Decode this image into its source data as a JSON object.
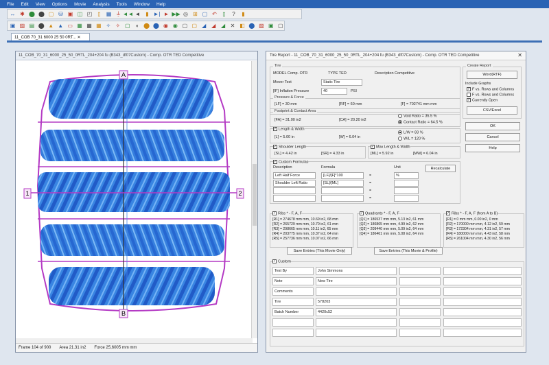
{
  "menu": [
    "File",
    "Edit",
    "View",
    "Options",
    "Movie",
    "Analysis",
    "Tools",
    "Window",
    "Help"
  ],
  "toolbar1": [
    "↔",
    "✱",
    "⬤",
    "⬤",
    "▢",
    "⛁",
    "▣",
    "◫",
    "◰",
    "▯",
    "▦",
    "⏚",
    "◄◄",
    "◄",
    "▮",
    "►|",
    "►",
    "▶▶",
    "◎",
    "⊞",
    "▢",
    "↶",
    "▯",
    "?",
    "▮"
  ],
  "toolbar2": [
    "▣",
    "▨",
    "▤",
    "⬤",
    "▲",
    "▲",
    "▭",
    "▦",
    "▦",
    "▦",
    "✧",
    "✧",
    "▢",
    "◖",
    "⬤",
    "⬤",
    "◉",
    "◉",
    "▢",
    "▢",
    "◢",
    "◢",
    "◢",
    "✕",
    "◧",
    "⬤",
    "▧",
    "▣",
    "▢"
  ],
  "document_tab": "11_COB 70_31 6000 25 50 0RT...  ✕",
  "left_window": {
    "title": "11_COB_70_31_6000_25_50_0RTL_204+204 fu (B343_df07Custom) - Comp. OTR TED Competitive",
    "markers": {
      "a": "A",
      "b": "B",
      "one": "1",
      "two": "2"
    },
    "status": {
      "frame": "Frame 104 of 900",
      "area": "Area 21.31 in2",
      "force": "Force 25,6005 mm mm"
    }
  },
  "report": {
    "title": "Tire Report - 11_COB_70_31_6000_25_50_0RTL_204+204 fu (B343_df07Custom) - Comp. OTR TED Competitive",
    "tire": {
      "group": "Tire",
      "model": "MODEL Comp. OTR",
      "type": "TYPE TED",
      "description": "Description Competitive",
      "mover_text_label": "Mover Test",
      "mover_text_value": "Static Tire",
      "inflation_label": "[IF] Inflation Pressure",
      "inflation_value": "40",
      "inflation_unit": "PSI"
    },
    "pressure": {
      "group": "Pressure & Force",
      "lf": "[LF] = 30 mm",
      "rf": "[RF] = 60 mm",
      "f": "[F] = 702741 mm mm"
    },
    "footprint": {
      "group": "Footprint & Contact Area",
      "fa": "[FA] = 31.00 in2",
      "ca": "[CA] = 20.20 in2",
      "void_ratio": "Void Ratio = 35.5 %",
      "contact_ratio": "Contact Ratio = 64.5 %"
    },
    "length": {
      "label": "Length & Width",
      "l": "[L] = 5.00 in",
      "w": "[W] = 6.04 in",
      "lw": "L/W = 83 %",
      "wl": "W/L = 120 %"
    },
    "shoulder": {
      "label": "Shoulder Length",
      "sl": "[SL] = 4.42 in",
      "sr": "[SR] = 4.33 in",
      "max_label": "Max Length & Width",
      "ml": "[ML] = 5.92 in",
      "mw": "[MW] = 6.04 in"
    },
    "custom_formulas": {
      "label": "Custom Formulas",
      "col_description": "Description",
      "col_formula": "Formula",
      "col_unit": "Unit",
      "recalc_button": "Recalculate",
      "rows": [
        {
          "desc": "Left Half Force",
          "formula": "[LF]/[F]*100",
          "eq": "=",
          "unit": "%"
        },
        {
          "desc": "Shoulder Left Ratio",
          "formula": "[SL]/[ML]",
          "eq": "=",
          "unit": ""
        },
        {
          "desc": "",
          "formula": "",
          "eq": "=",
          "unit": ""
        },
        {
          "desc": "",
          "formula": "",
          "eq": "=",
          "unit": ""
        }
      ]
    },
    "ribs": {
      "label": "Ribs * - F, A, F",
      "lines": [
        "[R1] = 274678 mm mm, 10.69 in2, 68 mm",
        "[R2] = 265729 mm mm, 10.70 in2, 61 mm",
        "[R3] = 298665 mm mm, 10.11 in2, 65 mm",
        "[R4] = 203775 mm mm, 10.37 in2, 64 mm",
        "[R5] = 257736 mm mm, 10.07 in2, 66 mm"
      ]
    },
    "quadrants": {
      "label": "Quadrants * - F, A, F",
      "lines": [
        "[Q1] = 186537 mm mm, 5.13 in2, 61 mm",
        "[Q2] = 186865 mm mm, 4.99 in2, 62 mm",
        "[Q3] = 209440 mm mm, 5.09 in2, 64 mm",
        "[Q4] = 186461 mm mm, 5.08 in2, 64 mm"
      ]
    },
    "ribs_ab": {
      "label": "Ribs * - F, A, F (from A to B)",
      "lines": [
        "[R1] = 0 mm mm, 0.00 in2, 0 mm",
        "[R2] = 170000 mm mm, 4.12 in2, 59 mm",
        "[R3] = 172304 mm mm, 4.31 in2, 57 mm",
        "[R4] = 180000 mm mm, 4.43 in2, 58 mm",
        "[R5] = 261004 mm mm, 4.30 in2, 56 mm"
      ]
    },
    "save_buttons": [
      "Save Entries (This Movie Only)",
      "Save Entries (This Movie & Profile)"
    ],
    "custom": {
      "label": "Custom",
      "rows": [
        {
          "k": "Test By",
          "v": "John Simmons"
        },
        {
          "k": "Note",
          "v": "New Tire"
        },
        {
          "k": "Comments",
          "v": ""
        },
        {
          "k": "Tire",
          "v": "578203"
        },
        {
          "k": "Batch Number",
          "v": "4420c52"
        },
        {
          "k": "",
          "v": ""
        },
        {
          "k": "",
          "v": ""
        }
      ]
    },
    "create_report": {
      "label": "Create Report",
      "pdf_button": "Word(RTF)",
      "include": "Include Graphs",
      "opt1": "F vs. Rows and Columns",
      "opt2": "F vs. Rows and Columns",
      "opt3": "Currently Open",
      "csv_button": "CSV/Excel"
    },
    "ok_button": "OK",
    "cancel_button": "Cancel",
    "help_button": "Help"
  }
}
